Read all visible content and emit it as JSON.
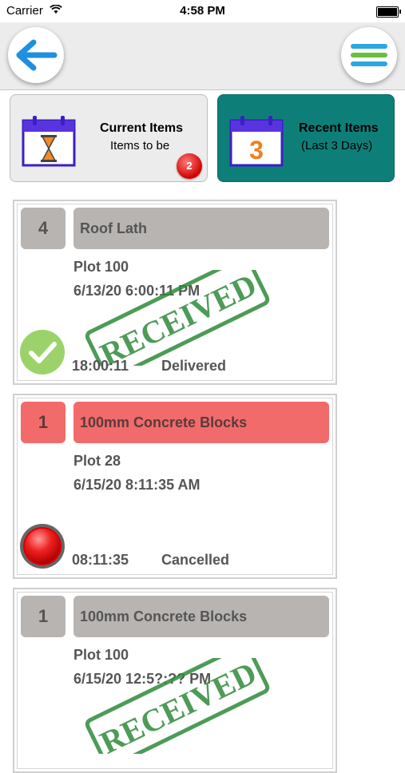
{
  "status_bar": {
    "carrier": "Carrier",
    "time": "4:58 PM"
  },
  "nav": {
    "back_icon": "arrow-left-icon",
    "menu_icon": "hamburger-menu-icon",
    "menu_colors": [
      "#2aa7e0",
      "#6cbf3c",
      "#2aa7e0"
    ]
  },
  "tiles": {
    "current": {
      "title": "Current Items",
      "subtitle": "Items to be",
      "badge": "2",
      "icon": "hourglass-calendar-icon"
    },
    "recent": {
      "title": "Recent Items",
      "subtitle": "(Last 3 Days)",
      "calendar_number": "3",
      "icon": "calendar-icon"
    }
  },
  "stamp_text": "RECEIVED",
  "cards": [
    {
      "qty": "4",
      "title": "Roof Lath",
      "plot": "Plot 100",
      "date": "6/13/20 6:00:11 PM",
      "time": "18:00:11",
      "status": "Delivered",
      "state": "received"
    },
    {
      "qty": "1",
      "title": "100mm Concrete Blocks",
      "plot": "Plot 28",
      "date": "6/15/20 8:11:35 AM",
      "time": "08:11:35",
      "status": "Cancelled",
      "state": "cancelled"
    },
    {
      "qty": "1",
      "title": "100mm Concrete Blocks",
      "plot": "Plot 100",
      "date": "6/15/20 12:5?:?? PM",
      "time": "",
      "status": "",
      "state": "received"
    }
  ],
  "colors": {
    "teal": "#0e7f78",
    "cancel_red": "#f26b6b",
    "stamp_green": "#2f8a3a",
    "check_green": "#9bd36a"
  }
}
